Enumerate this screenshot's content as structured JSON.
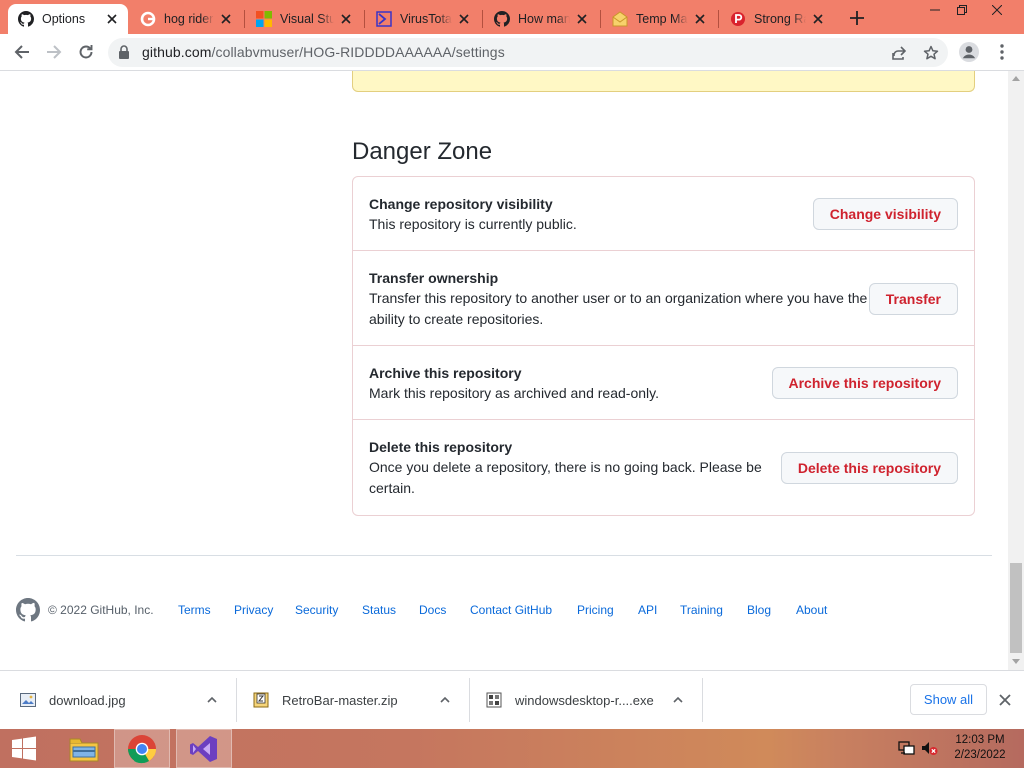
{
  "browser": {
    "tabs": [
      {
        "title": "Options",
        "icon": "github-icon",
        "active": true
      },
      {
        "title": "hog rider",
        "icon": "google-icon",
        "active": false
      },
      {
        "title": "Visual Stu",
        "icon": "microsoft-icon",
        "active": false
      },
      {
        "title": "VirusTotal",
        "icon": "virustotal-icon",
        "active": false
      },
      {
        "title": "How man",
        "icon": "github-icon",
        "active": false
      },
      {
        "title": "Temp Ma",
        "icon": "temp-mail-icon",
        "active": false
      },
      {
        "title": "Strong Ra",
        "icon": "strong-random-icon",
        "active": false
      }
    ],
    "url": {
      "host": "github.com",
      "path": "/collabvmuser/HOG-RIDDDDAAAAAA/settings"
    }
  },
  "danger_zone": {
    "title": "Danger Zone",
    "rows": [
      {
        "heading": "Change repository visibility",
        "description": "This repository is currently public.",
        "button": "Change visibility"
      },
      {
        "heading": "Transfer ownership",
        "description_lines": [
          "Transfer this repository to another user or to an organization where you have the",
          "ability to create repositories."
        ],
        "button": "Transfer"
      },
      {
        "heading": "Archive this repository",
        "description": "Mark this repository as archived and read-only.",
        "button": "Archive this repository"
      },
      {
        "heading": "Delete this repository",
        "description_lines": [
          "Once you delete a repository, there is no going back. Please be",
          "certain."
        ],
        "button": "Delete this repository"
      }
    ]
  },
  "footer": {
    "copyright": "© 2022 GitHub, Inc.",
    "links": [
      "Terms",
      "Privacy",
      "Security",
      "Status",
      "Docs",
      "Contact GitHub",
      "Pricing",
      "API",
      "Training",
      "Blog",
      "About"
    ]
  },
  "downloads": {
    "items": [
      {
        "name": "download.jpg",
        "icon": "image-file-icon"
      },
      {
        "name": "RetroBar-master.zip",
        "icon": "zip-file-icon"
      },
      {
        "name": "windowsdesktop-r....exe",
        "icon": "installer-file-icon"
      }
    ],
    "show_all": "Show all"
  },
  "taskbar": {
    "apps": [
      "windows-start-icon",
      "file-explorer-icon",
      "chrome-icon",
      "visual-studio-icon"
    ],
    "time": "12:03 PM",
    "date": "2/23/2022"
  },
  "colors": {
    "danger": "#cf222e",
    "link": "#0969da",
    "tabstrip": "#f27f6a"
  }
}
